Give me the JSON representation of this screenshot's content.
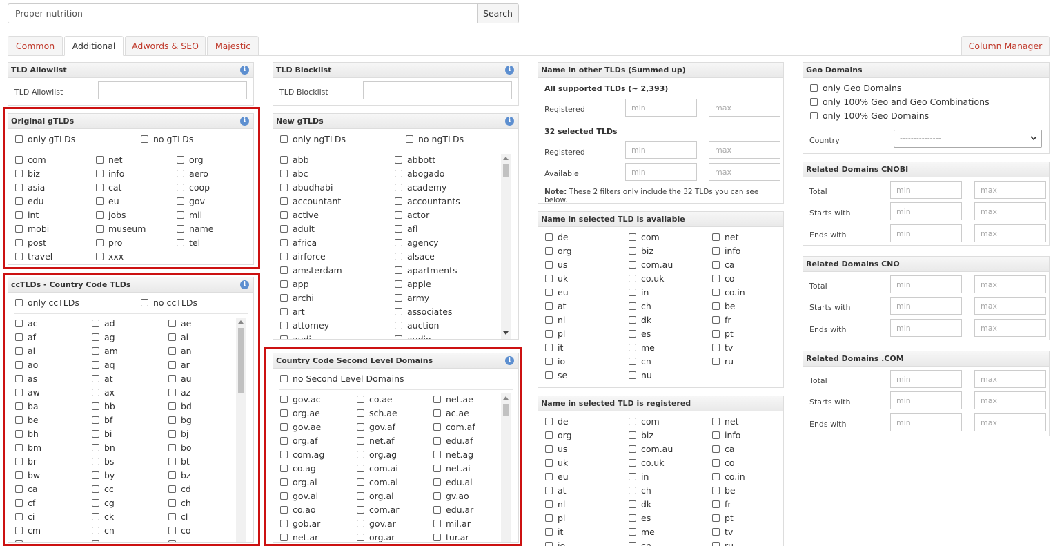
{
  "search": {
    "value": "Proper nutrition",
    "button": "Search"
  },
  "tabs": [
    "Common",
    "Additional",
    "Adwords & SEO",
    "Majestic"
  ],
  "column_manager": "Column Manager",
  "tld_allowlist": {
    "title": "TLD Allowlist",
    "label": "TLD Allowlist"
  },
  "tld_blocklist": {
    "title": "TLD Blocklist",
    "label": "TLD Blocklist"
  },
  "original_gtlds": {
    "title": "Original gTLDs",
    "only": "only gTLDs",
    "no": "no gTLDs",
    "items": [
      "com",
      "net",
      "org",
      "biz",
      "info",
      "aero",
      "asia",
      "cat",
      "coop",
      "edu",
      "eu",
      "gov",
      "int",
      "jobs",
      "mil",
      "mobi",
      "museum",
      "name",
      "post",
      "pro",
      "tel",
      "travel",
      "xxx"
    ]
  },
  "cctlds": {
    "title": "ccTLDs - Country Code TLDs",
    "only": "only ccTLDs",
    "no": "no ccTLDs",
    "items": [
      "ac",
      "ad",
      "ae",
      "af",
      "ag",
      "ai",
      "al",
      "am",
      "an",
      "ao",
      "aq",
      "ar",
      "as",
      "at",
      "au",
      "aw",
      "ax",
      "az",
      "ba",
      "bb",
      "bd",
      "be",
      "bf",
      "bg",
      "bh",
      "bi",
      "bj",
      "bm",
      "bn",
      "bo",
      "br",
      "bs",
      "bt",
      "bw",
      "by",
      "bz",
      "ca",
      "cc",
      "cd",
      "cf",
      "cg",
      "ch",
      "ci",
      "ck",
      "cl",
      "cm",
      "cn",
      "co",
      "cr",
      "cu",
      "cv"
    ]
  },
  "new_gtlds": {
    "title": "New gTLDs",
    "only": "only ngTLDs",
    "no": "no ngTLDs",
    "items": [
      "abb",
      "abbott",
      "abc",
      "abogado",
      "abudhabi",
      "academy",
      "accountant",
      "accountants",
      "active",
      "actor",
      "adult",
      "afl",
      "africa",
      "agency",
      "airforce",
      "alsace",
      "amsterdam",
      "apartments",
      "app",
      "apple",
      "archi",
      "army",
      "art",
      "associates",
      "attorney",
      "auction",
      "audi",
      "audio"
    ]
  },
  "second_level": {
    "title": "Country Code Second Level Domains",
    "no": "no Second Level Domains",
    "items": [
      "gov.ac",
      "co.ae",
      "net.ae",
      "org.ae",
      "sch.ae",
      "ac.ae",
      "gov.ae",
      "gov.af",
      "com.af",
      "org.af",
      "net.af",
      "edu.af",
      "com.ag",
      "org.ag",
      "net.ag",
      "co.ag",
      "com.ai",
      "net.ai",
      "org.ai",
      "com.al",
      "edu.al",
      "gov.al",
      "org.al",
      "gv.ao",
      "co.ao",
      "com.ar",
      "edu.ar",
      "gob.ar",
      "gov.ar",
      "mil.ar",
      "net.ar",
      "org.ar",
      "tur.ar"
    ]
  },
  "name_other_tlds": {
    "title": "Name in other TLDs (Summed up)",
    "all_label": "All supported TLDs (~ 2,393)",
    "registered": "Registered",
    "selected_label": "32 selected TLDs",
    "available": "Available",
    "min": "min",
    "max": "max",
    "note_bold": "Note:",
    "note": " These 2 filters only include the 32 TLDs you can see below."
  },
  "name_available": {
    "title": "Name in selected TLD is available",
    "items": [
      "de",
      "com",
      "net",
      "org",
      "biz",
      "info",
      "us",
      "com.au",
      "ca",
      "uk",
      "co.uk",
      "co",
      "eu",
      "in",
      "co.in",
      "at",
      "ch",
      "be",
      "nl",
      "dk",
      "fr",
      "pl",
      "es",
      "pt",
      "it",
      "me",
      "tv",
      "io",
      "cn",
      "ru",
      "se",
      "nu"
    ]
  },
  "name_registered": {
    "title": "Name in selected TLD is registered",
    "items": [
      "de",
      "com",
      "net",
      "org",
      "biz",
      "info",
      "us",
      "com.au",
      "ca",
      "uk",
      "co.uk",
      "co",
      "eu",
      "in",
      "co.in",
      "at",
      "ch",
      "be",
      "nl",
      "dk",
      "fr",
      "pl",
      "es",
      "pt",
      "it",
      "me",
      "tv",
      "io",
      "cn",
      "ru"
    ]
  },
  "geo": {
    "title": "Geo Domains",
    "opts": [
      "only Geo Domains",
      "only 100% Geo and Geo Combinations",
      "only 100% Geo Domains"
    ],
    "country_label": "Country",
    "country_value": "---------------"
  },
  "rel_cnobi": {
    "title": "Related Domains CNOBI"
  },
  "rel_cno": {
    "title": "Related Domains CNO"
  },
  "rel_com": {
    "title": "Related Domains .COM"
  },
  "rel_labels": {
    "total": "Total",
    "starts": "Starts with",
    "ends": "Ends with",
    "min": "min",
    "max": "max"
  },
  "colors": {
    "accent_red": "#cc1111",
    "tab_link": "#c0392b",
    "info_blue": "#5d8fd0"
  }
}
